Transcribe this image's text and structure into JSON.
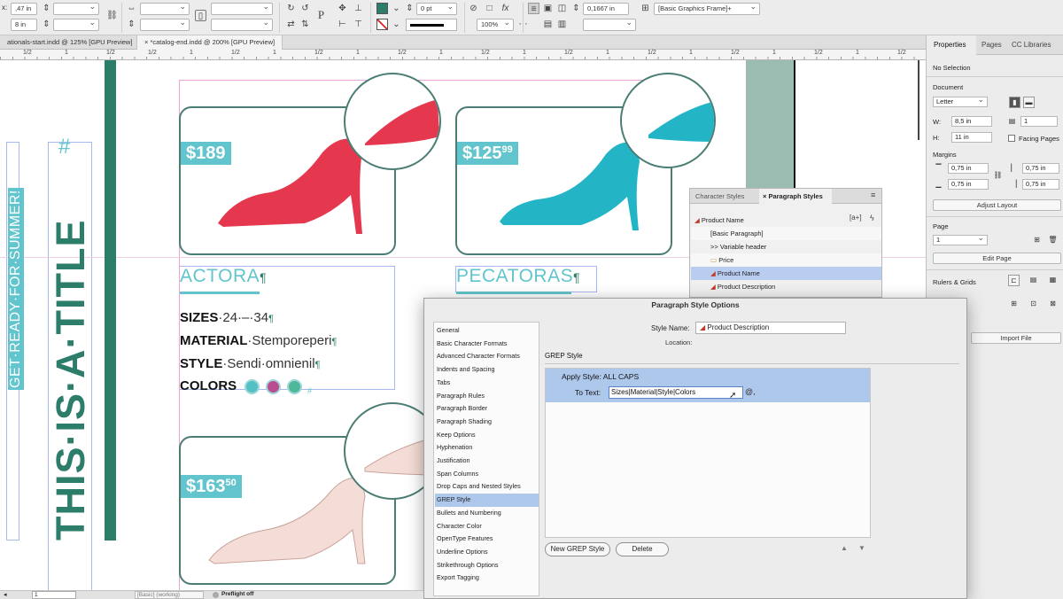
{
  "control_bar": {
    "x_value": ",47 in",
    "y_value": "8 in",
    "stroke_weight": "0 pt",
    "scale_percent": "100%",
    "gap_value": "0,1667 in",
    "object_style": "[Basic Graphics Frame]+",
    "fill_color": "#2d7d6b",
    "stroke_color": "#000000"
  },
  "tabs": [
    {
      "label": "ationals-start.indd @ 125% [GPU Preview]"
    },
    {
      "label": "*catalog-end.indd @ 200% [GPU Preview]"
    }
  ],
  "ruler": {
    "marks": [
      "1/2",
      "1",
      "1/2",
      "1/2",
      "1",
      "1/2",
      "1",
      "1/2",
      "1",
      "1/2",
      "1",
      "1/2",
      "1",
      "1/2",
      "1",
      "1/2",
      "1",
      "1/2",
      "1",
      "1/2",
      "1",
      "1/2"
    ]
  },
  "canvas": {
    "sidebar_text_outline": "GET·READY·FOR·SUMMER!",
    "sidebar_text_big": "THIS·IS·A·TITLE",
    "hash_mark": "#",
    "products": [
      {
        "price_main": "$189",
        "price_cents": "",
        "shoe_color": "#e5384f",
        "name": "ACTORA"
      },
      {
        "price_main": "$125",
        "price_cents": "99",
        "shoe_color": "#23b5c6",
        "name": "PECATORAS"
      },
      {
        "price_main": "$163",
        "price_cents": "50",
        "shoe_color": "#f4ddd7",
        "name": ""
      }
    ],
    "pilcrow": "¶",
    "specs": [
      {
        "label": "SIZES",
        "value": "·24·–·34"
      },
      {
        "label": "MATERIAL",
        "value": "·Stemporeperi"
      },
      {
        "label": "STYLE",
        "value": "·Sendi·omnienil"
      },
      {
        "label": "COLORS",
        "value": ""
      }
    ],
    "swatches": [
      "#52c0c5",
      "#b94d8f",
      "#4fb89a"
    ]
  },
  "properties_panel": {
    "tabs": [
      "Properties",
      "Pages",
      "CC Libraries"
    ],
    "selection": "No Selection",
    "document_label": "Document",
    "page_size": "Letter",
    "width_label": "W:",
    "width": "8,5 in",
    "height_label": "H:",
    "height": "11 in",
    "pages_count": "1",
    "facing_pages": "Facing Pages",
    "margins_label": "Margins",
    "margins": [
      "0,75 in",
      "0,75 in",
      "0,75 in",
      "0,75 in"
    ],
    "adjust_layout": "Adjust Layout",
    "page_label": "Page",
    "page_number": "1",
    "edit_page": "Edit Page",
    "rulers_grids": "Rulers & Grids",
    "import_file": "Import File"
  },
  "styles_panel": {
    "tabs": [
      "Character Styles",
      "Paragraph Styles"
    ],
    "current": "Product Name",
    "items": [
      {
        "label": "[Basic Paragraph]",
        "prefix": ""
      },
      {
        "label": "Variable header",
        "prefix": ">>"
      },
      {
        "label": "Price",
        "prefix": ""
      },
      {
        "label": "Product Name",
        "prefix": ""
      },
      {
        "label": "Product Description",
        "prefix": ""
      }
    ]
  },
  "dialog": {
    "title": "Paragraph Style Options",
    "categories": [
      "General",
      "Basic Character Formats",
      "Advanced Character Formats",
      "Indents and Spacing",
      "Tabs",
      "Paragraph Rules",
      "Paragraph Border",
      "Paragraph Shading",
      "Keep Options",
      "Hyphenation",
      "Justification",
      "Span Columns",
      "Drop Caps and Nested Styles",
      "GREP Style",
      "Bullets and Numbering",
      "Character Color",
      "OpenType Features",
      "Underline Options",
      "Strikethrough Options",
      "Export Tagging"
    ],
    "selected_category": "GREP Style",
    "style_name_label": "Style Name:",
    "style_name": "Product Description",
    "location_label": "Location:",
    "section_title": "GREP Style",
    "apply_style_label": "Apply Style:",
    "apply_style_value": "ALL CAPS",
    "to_text_label": "To Text:",
    "to_text_value": "Sizes|Material|Style|Colors",
    "at_symbol": "@,",
    "new_grep_button": "New GREP Style",
    "delete_button": "Delete"
  },
  "status_bar": {
    "page_field": "1",
    "style_field": "[Basic] (working)",
    "preflight": "Preflight off"
  }
}
